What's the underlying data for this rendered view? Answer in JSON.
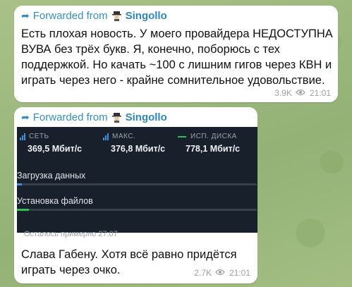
{
  "messages": [
    {
      "forwarded_prefix": "Forwarded from",
      "forwarded_from": "Singollo",
      "text": "Есть плохая новость. У моего провайдера НЕДОСТУПНА ВУВА без трёх букв. Я, конечно, поборюсь с тех поддержкой. Но качать ~100 с лишним гигов через КВН и играть через него - крайне сомнительное удовольствие.",
      "views": "3.9K",
      "time": "21:01"
    },
    {
      "forwarded_prefix": "Forwarded from",
      "forwarded_from": "Singollo",
      "download_panel": {
        "stats": [
          {
            "label": "СЕТЬ",
            "value": "369,5 Мбит/с",
            "icon": "bar-chart-icon"
          },
          {
            "label": "МАКС.",
            "value": "376,8 Мбит/с",
            "icon": "bar-chart-icon"
          },
          {
            "label": "ИСП. ДИСКА",
            "value": "778,1 Мбит/с",
            "icon": "green-line-icon"
          }
        ],
        "progress": [
          {
            "label": "Загрузка данных",
            "fraction": 0.02,
            "color": "#3d8fe0"
          },
          {
            "label": "Установка файлов",
            "fraction": 0.05,
            "color": "#2fbf57"
          }
        ],
        "remaining": "Осталось примерно 27:07"
      },
      "text": "Слава Габену. Хотя всё равно придётся играть через очко.",
      "views": "2.7K",
      "time": "21:01"
    }
  ]
}
